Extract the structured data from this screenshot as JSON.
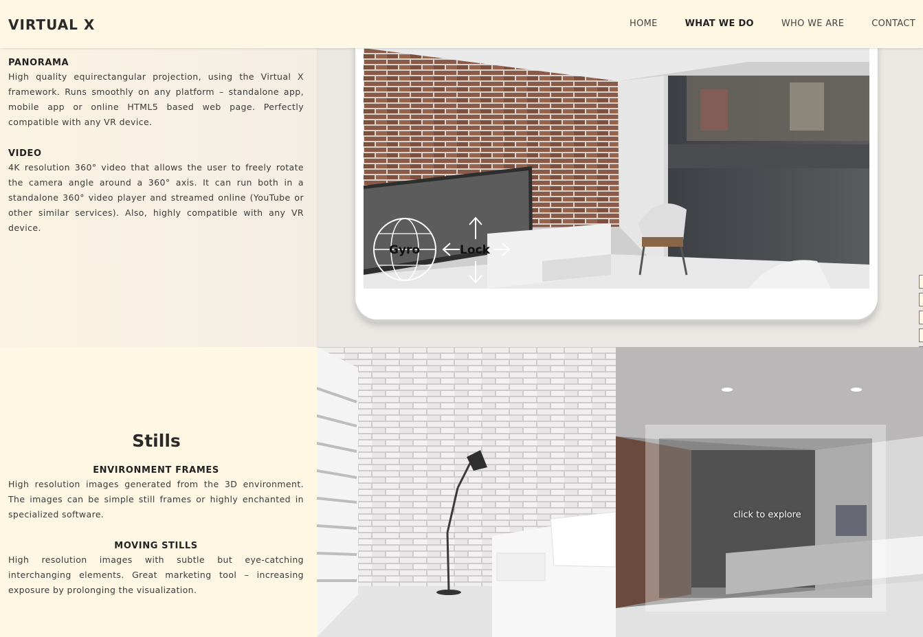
{
  "header": {
    "logo": "VIRTUAL X",
    "nav": [
      "HOME",
      "WHAT WE DO",
      "WHO WE ARE",
      "CONTACT"
    ]
  },
  "panorama": {
    "heading": "PANORAMA",
    "text": "High quality equirectangular projection, using the Virtual X framework. Runs smoothly on any platform – standalone app, mobile app or online HTML5 based web page. Perfectly compatible with any VR device."
  },
  "video": {
    "heading": "VIDEO",
    "text": "4K resolution 360° video that allows the user to freely rotate the camera angle around a 360° axis. It can run both in a standalone 360° video player and streamed online (YouTube or other similar services). Also, highly compatible with any VR device."
  },
  "viewer": {
    "gyro_label": "Gyro",
    "lock_label": "Lock"
  },
  "stills": {
    "title": "Stills",
    "env_heading": "ENVIRONMENT FRAMES",
    "env_text": "High resolution images generated from the 3D environment. The images can be simple still frames or highly enchanted in specialized software.",
    "moving_heading": "MOVING STILLS",
    "moving_text": "High resolution images with subtle but eye-catching interchanging elements. Great marketing tool – increasing exposure by prolonging the visualization."
  },
  "gallery": {
    "explore_label": "click to explore"
  }
}
